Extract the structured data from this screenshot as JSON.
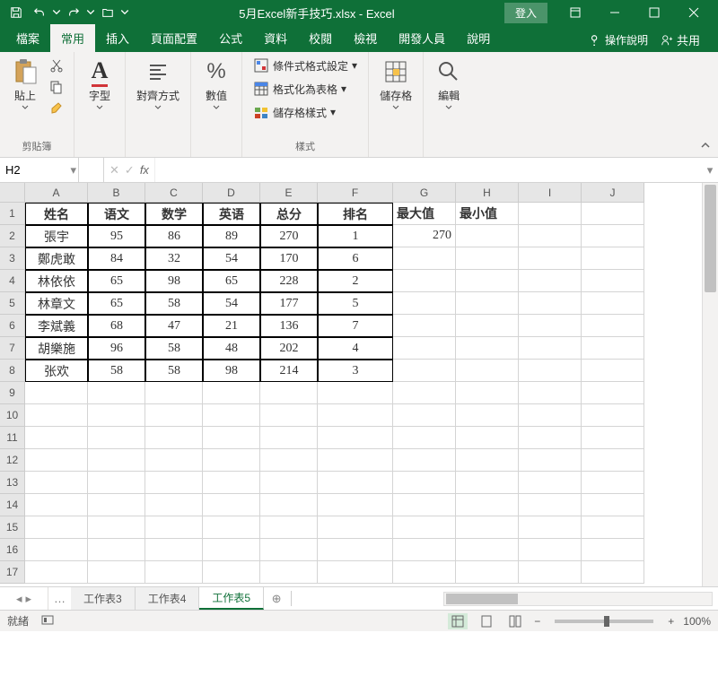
{
  "title": "5月Excel新手技巧.xlsx - Excel",
  "login": "登入",
  "tabs": {
    "file": "檔案",
    "home": "常用",
    "insert": "插入",
    "layout": "頁面配置",
    "formulas": "公式",
    "data": "資料",
    "review": "校閱",
    "view": "檢視",
    "dev": "開發人員",
    "help": "說明",
    "tellme": "操作說明",
    "share": "共用"
  },
  "ribbon": {
    "clipboard": "剪貼簿",
    "paste": "貼上",
    "font": "字型",
    "align": "對齊方式",
    "number": "數值",
    "styles": "樣式",
    "cells": "儲存格",
    "editing": "編輯",
    "condfmt": "條件式格式設定",
    "tablefmt": "格式化為表格",
    "cellstyle": "儲存格樣式"
  },
  "nameBox": "H2",
  "fx": "fx",
  "columns": [
    "A",
    "B",
    "C",
    "D",
    "E",
    "F",
    "G",
    "H",
    "I",
    "J"
  ],
  "rows": [
    "1",
    "2",
    "3",
    "4",
    "5",
    "6",
    "7",
    "8",
    "9",
    "10",
    "11",
    "12",
    "13",
    "14",
    "15",
    "16",
    "17"
  ],
  "headers": {
    "A": "姓名",
    "B": "语文",
    "C": "数学",
    "D": "英语",
    "E": "总分",
    "F": "排名",
    "G": "最大值",
    "H": "最小值"
  },
  "data": [
    {
      "A": "張宇",
      "B": "95",
      "C": "86",
      "D": "89",
      "E": "270",
      "F": "1"
    },
    {
      "A": "鄭虎敢",
      "B": "84",
      "C": "32",
      "D": "54",
      "E": "170",
      "F": "6"
    },
    {
      "A": "林依依",
      "B": "65",
      "C": "98",
      "D": "65",
      "E": "228",
      "F": "2"
    },
    {
      "A": "林章文",
      "B": "65",
      "C": "58",
      "D": "54",
      "E": "177",
      "F": "5"
    },
    {
      "A": "李斌義",
      "B": "68",
      "C": "47",
      "D": "21",
      "E": "136",
      "F": "7"
    },
    {
      "A": "胡樂施",
      "B": "96",
      "C": "58",
      "D": "48",
      "E": "202",
      "F": "4"
    },
    {
      "A": "张欢",
      "B": "58",
      "C": "58",
      "D": "98",
      "E": "214",
      "F": "3"
    }
  ],
  "G2": "270",
  "sheets": {
    "s3": "工作表3",
    "s4": "工作表4",
    "s5": "工作表5"
  },
  "status": {
    "ready": "就緒",
    "zoom": "100%"
  }
}
